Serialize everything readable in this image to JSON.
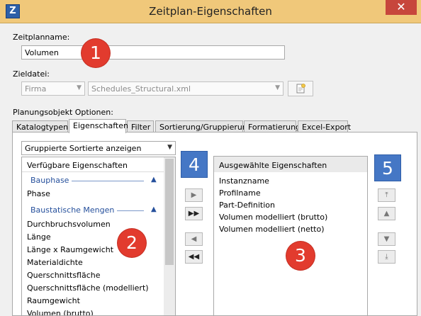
{
  "window": {
    "title": "Zeitplan-Eigenschaften",
    "app_icon_letter": "Z",
    "close_glyph": "✕"
  },
  "name": {
    "label": "Zeitplanname:",
    "value": "Volumen"
  },
  "file": {
    "label": "Zieldatei:",
    "company_value": "Firma",
    "schedule_value": "Schedules_Structural.xml"
  },
  "options_label": "Planungsobjekt Optionen:",
  "tabs": [
    {
      "label": "Katalogtypen",
      "active": false
    },
    {
      "label": "Eigenschaften",
      "active": true
    },
    {
      "label": "Filter",
      "active": false
    },
    {
      "label": "Sortierung/Gruppierung",
      "active": false
    },
    {
      "label": "Formatierung",
      "active": false
    },
    {
      "label": "Excel-Export",
      "active": false
    }
  ],
  "left_panel": {
    "dropdown_value": "Gruppierte Sortierte anzeigen",
    "header": "Verfügbare Eigenschaften",
    "groups": [
      {
        "name": "Bauphase",
        "items": [
          "Phase"
        ]
      },
      {
        "name": "Baustatische Mengen",
        "items": [
          "Durchbruchsvolumen",
          "Länge",
          "Länge x Raumgewicht",
          "Materialdichte",
          "Querschnittsfläche",
          "Querschnittsfläche (modelliert)",
          "Raumgewicht",
          "Volumen (brutto)"
        ]
      }
    ]
  },
  "right_panel": {
    "header": "Ausgewählte Eigenschaften",
    "items": [
      "Instanzname",
      "Profilname",
      "Part-Definition",
      "Volumen modelliert (brutto)",
      "Volumen modelliert (netto)"
    ]
  },
  "move_buttons": {
    "add": "▶",
    "add_all": "▶▶",
    "remove": "◀",
    "remove_all": "◀◀"
  },
  "order_buttons": {
    "to_top": "⤒",
    "up": "▲",
    "down": "▼",
    "to_bottom": "⤓"
  },
  "callouts": {
    "c1": "1",
    "c2": "2",
    "c3": "3",
    "c4": "4",
    "c5": "5"
  },
  "colors": {
    "titlebar": "#f0c87a",
    "callout_red": "#e23b2e",
    "callout_blue": "#4577c5",
    "group_text": "#26509c"
  }
}
